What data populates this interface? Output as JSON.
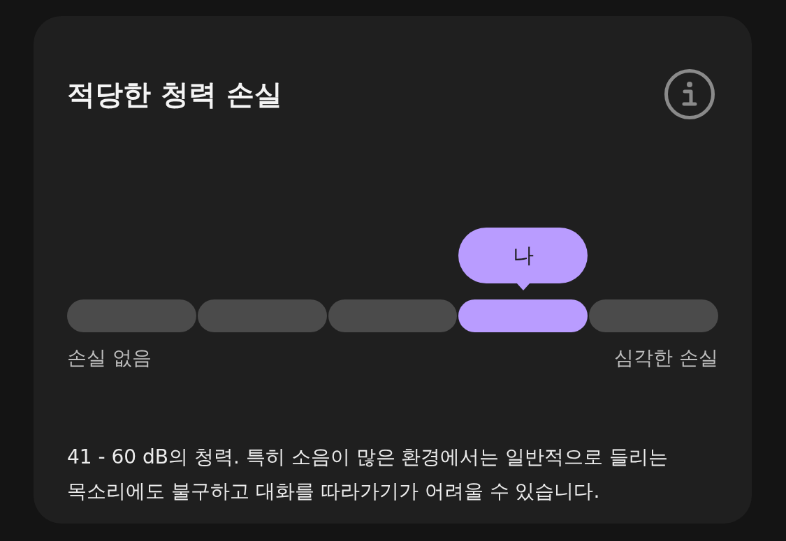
{
  "card": {
    "title": "적당한 청력 손실",
    "scale": {
      "marker": {
        "label": "나"
      },
      "segments": [
        {
          "selected": false
        },
        {
          "selected": false
        },
        {
          "selected": false
        },
        {
          "selected": true
        },
        {
          "selected": false
        }
      ],
      "min_label": "손실 없음",
      "max_label": "심각한 손실"
    },
    "description": [
      "41 - 60 dB의 청력. 특히 소음이 많은 환경에서는 일반적으로 들리는",
      "목소리에도 불구하고 대화를 따라가기가 어려울 수 있습니다."
    ]
  }
}
